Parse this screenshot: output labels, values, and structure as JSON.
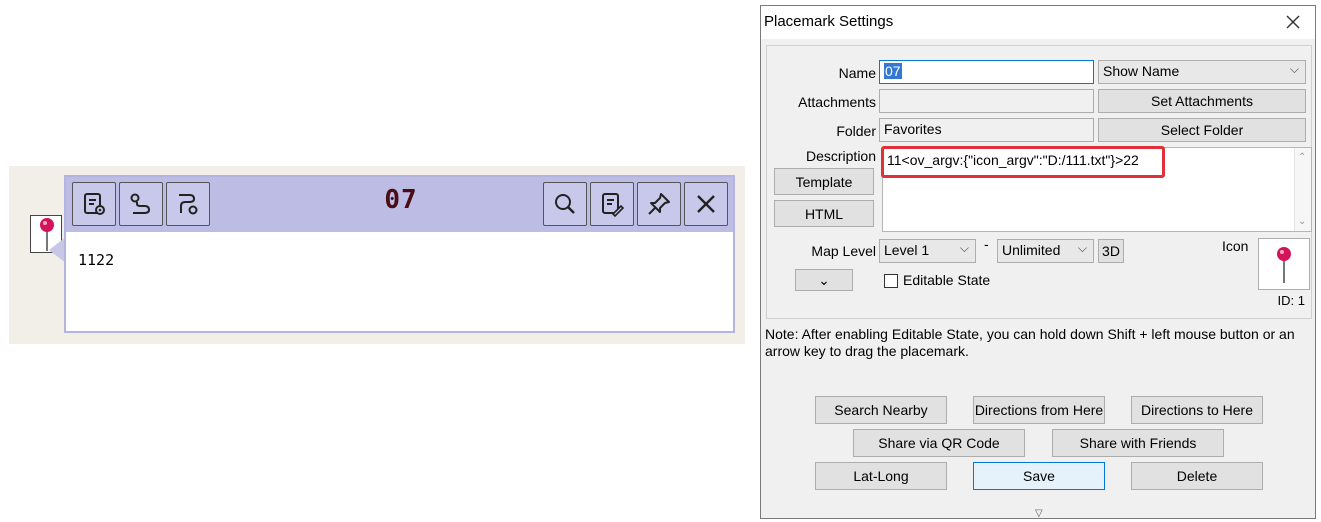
{
  "popup": {
    "title": "07",
    "body": "1122",
    "icons": [
      "placemark-settings-icon",
      "route-icon",
      "directions-icon",
      "search-icon",
      "edit-icon",
      "pin-icon",
      "close-icon"
    ]
  },
  "dialog": {
    "title": "Placemark Settings",
    "name_label": "Name",
    "name_value": "07",
    "show_name_option": "Show Name",
    "attachments_label": "Attachments",
    "set_attachments_button": "Set Attachments",
    "folder_label": "Folder",
    "folder_value": "Favorites",
    "select_folder_button": "Select Folder",
    "description_label": "Description",
    "description_value": "11<ov_argv:{\"icon_argv\":\"D:/111.txt\"}>22",
    "template_button": "Template",
    "html_button": "HTML",
    "map_level_label": "Map Level",
    "level_from": "Level 1",
    "level_separator": "-",
    "level_to": "Unlimited",
    "three_d_button": "3D",
    "icon_label": "Icon",
    "expand_button": "⌄",
    "editable_state_label": "Editable State",
    "editable_state_checked": false,
    "id_label": "ID: 1",
    "note": "Note: After enabling Editable State, you can hold down Shift + left mouse button or an arrow key to drag the placemark.",
    "buttons": {
      "search_nearby": "Search Nearby",
      "directions_from": "Directions from Here",
      "directions_to": "Directions to Here",
      "share_qr": "Share via QR Code",
      "share_friends": "Share with Friends",
      "lat_long": "Lat-Long",
      "save": "Save",
      "delete": "Delete"
    }
  },
  "colors": {
    "popup_header": "#bcbce4",
    "popup_title": "#4a0d13",
    "highlight_box": "#e0303a",
    "selection": "#3478d4",
    "pin_head": "#d4145a"
  }
}
